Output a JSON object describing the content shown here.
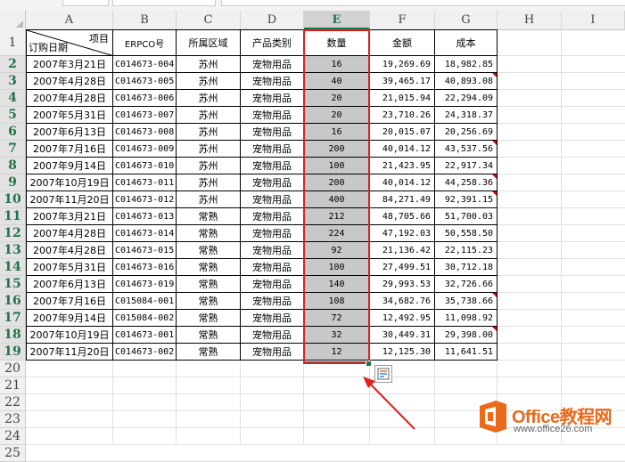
{
  "columns": [
    "A",
    "B",
    "C",
    "D",
    "E",
    "F",
    "G",
    "H",
    "I"
  ],
  "selected_column": "E",
  "row_numbers": [
    "1",
    "2",
    "3",
    "4",
    "5",
    "6",
    "7",
    "8",
    "9",
    "10",
    "11",
    "12",
    "13",
    "14",
    "15",
    "16",
    "17",
    "18",
    "19",
    "20",
    "21",
    "22",
    "23",
    "24",
    "25"
  ],
  "header": {
    "a1_top": "项目",
    "a1_bottom": "订购日期",
    "b": "ERPCO号",
    "c": "所属区域",
    "d": "产品类别",
    "e": "数量",
    "f": "金额",
    "g": "成本"
  },
  "rows": [
    {
      "date": "2007年3月21日",
      "erp": "C014673-004",
      "region": "苏州",
      "category": "宠物用品",
      "qty": "16",
      "amount": "19,269.69",
      "cost": "18,982.85",
      "flag": false
    },
    {
      "date": "2007年4月28日",
      "erp": "C014673-005",
      "region": "苏州",
      "category": "宠物用品",
      "qty": "40",
      "amount": "39,465.17",
      "cost": "40,893.08",
      "flag": true
    },
    {
      "date": "2007年4月28日",
      "erp": "C014673-006",
      "region": "苏州",
      "category": "宠物用品",
      "qty": "20",
      "amount": "21,015.94",
      "cost": "22,294.09",
      "flag": false
    },
    {
      "date": "2007年5月31日",
      "erp": "C014673-007",
      "region": "苏州",
      "category": "宠物用品",
      "qty": "20",
      "amount": "23,710.26",
      "cost": "24,318.37",
      "flag": false
    },
    {
      "date": "2007年6月13日",
      "erp": "C014673-008",
      "region": "苏州",
      "category": "宠物用品",
      "qty": "16",
      "amount": "20,015.07",
      "cost": "20,256.69",
      "flag": false
    },
    {
      "date": "2007年7月16日",
      "erp": "C014673-009",
      "region": "苏州",
      "category": "宠物用品",
      "qty": "200",
      "amount": "40,014.12",
      "cost": "43,537.56",
      "flag": true
    },
    {
      "date": "2007年9月14日",
      "erp": "C014673-010",
      "region": "苏州",
      "category": "宠物用品",
      "qty": "100",
      "amount": "21,423.95",
      "cost": "22,917.34",
      "flag": false
    },
    {
      "date": "2007年10月19日",
      "erp": "C014673-011",
      "region": "苏州",
      "category": "宠物用品",
      "qty": "200",
      "amount": "40,014.12",
      "cost": "44,258.36",
      "flag": true
    },
    {
      "date": "2007年11月20日",
      "erp": "C014673-012",
      "region": "苏州",
      "category": "宠物用品",
      "qty": "400",
      "amount": "84,271.49",
      "cost": "92,391.15",
      "flag": true
    },
    {
      "date": "2007年3月21日",
      "erp": "C014673-013",
      "region": "常熟",
      "category": "宠物用品",
      "qty": "212",
      "amount": "48,705.66",
      "cost": "51,700.03",
      "flag": false
    },
    {
      "date": "2007年4月28日",
      "erp": "C014673-014",
      "region": "常熟",
      "category": "宠物用品",
      "qty": "224",
      "amount": "47,192.03",
      "cost": "50,558.50",
      "flag": false
    },
    {
      "date": "2007年4月28日",
      "erp": "C014673-015",
      "region": "常熟",
      "category": "宠物用品",
      "qty": "92",
      "amount": "21,136.42",
      "cost": "22,115.23",
      "flag": false
    },
    {
      "date": "2007年5月31日",
      "erp": "C014673-016",
      "region": "常熟",
      "category": "宠物用品",
      "qty": "100",
      "amount": "27,499.51",
      "cost": "30,712.18",
      "flag": false
    },
    {
      "date": "2007年6月13日",
      "erp": "C014673-019",
      "region": "常熟",
      "category": "宠物用品",
      "qty": "140",
      "amount": "29,993.53",
      "cost": "32,726.66",
      "flag": false
    },
    {
      "date": "2007年7月16日",
      "erp": "C015084-001",
      "region": "常熟",
      "category": "宠物用品",
      "qty": "108",
      "amount": "34,682.76",
      "cost": "35,738.66",
      "flag": true
    },
    {
      "date": "2007年9月14日",
      "erp": "C015084-002",
      "region": "常熟",
      "category": "宠物用品",
      "qty": "72",
      "amount": "12,492.95",
      "cost": "11,098.92",
      "flag": false
    },
    {
      "date": "2007年10月19日",
      "erp": "C014673-001",
      "region": "常熟",
      "category": "宠物用品",
      "qty": "32",
      "amount": "30,449.31",
      "cost": "29,398.00",
      "flag": true
    },
    {
      "date": "2007年11月20日",
      "erp": "C014673-002",
      "region": "常熟",
      "category": "宠物用品",
      "qty": "12",
      "amount": "12,125.30",
      "cost": "11,641.51",
      "flag": false
    }
  ],
  "quick_analysis_icon": "quick-analysis-icon",
  "watermark": {
    "title": "Office教程网",
    "url": "www.office26.com",
    "icon": "office-logo-icon"
  },
  "colors": {
    "selection_border": "#e02020",
    "arrow": "#e02020",
    "excel_green": "#217346",
    "selected_fill": "#c8c8c8",
    "flag_red": "#d40000",
    "logo_orange": "#e86a1a"
  }
}
